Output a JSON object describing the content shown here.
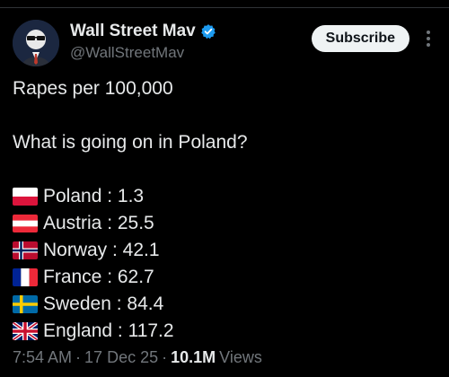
{
  "post": {
    "author": {
      "display_name": "Wall Street Mav",
      "handle": "@WallStreetMav",
      "verified": true,
      "avatar_icon": "avatar-icon"
    },
    "subscribe_label": "Subscribe",
    "text": {
      "line1": "Rapes per 100,000",
      "line2": "What is going on in Poland?"
    },
    "stats": [
      {
        "flag_icon": "poland-flag-icon",
        "label": "Poland : 1.3"
      },
      {
        "flag_icon": "austria-flag-icon",
        "label": "Austria : 25.5"
      },
      {
        "flag_icon": "norway-flag-icon",
        "label": "Norway : 42.1"
      },
      {
        "flag_icon": "france-flag-icon",
        "label": "France : 62.7"
      },
      {
        "flag_icon": "sweden-flag-icon",
        "label": "Sweden : 84.4"
      },
      {
        "flag_icon": "uk-flag-icon",
        "label": "England : 117.2"
      }
    ],
    "meta": {
      "time": "7:54 AM",
      "date": "17 Dec 25",
      "separator": "·",
      "views_count": "10.1M",
      "views_label": "Views"
    }
  },
  "colors": {
    "background": "#000000",
    "text": "#e7e9ea",
    "secondary_text": "#71767b",
    "verified": "#1d9bf0",
    "button_bg": "#eff3f4"
  }
}
